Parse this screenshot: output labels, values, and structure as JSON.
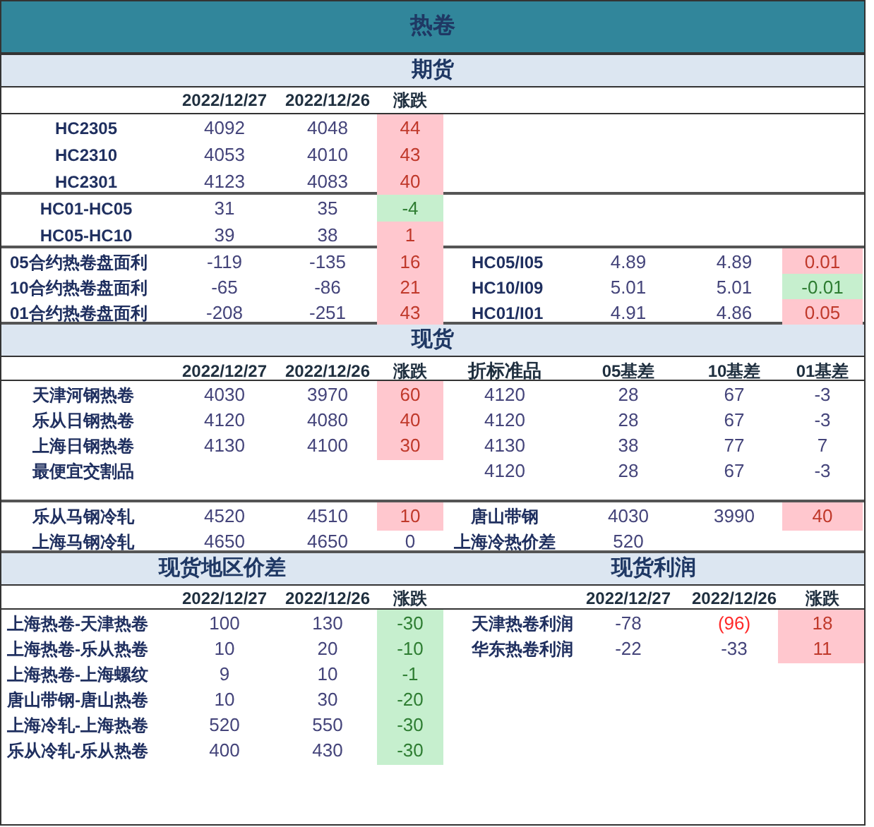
{
  "title": "热卷",
  "futures": {
    "heading": "期货",
    "columns": [
      "2022/12/27",
      "2022/12/26",
      "涨跌"
    ],
    "contracts": [
      {
        "name": "HC2305",
        "today": "4092",
        "prev": "4048",
        "change": "44",
        "gain": true,
        "loss": false
      },
      {
        "name": "HC2310",
        "today": "4053",
        "prev": "4010",
        "change": "43",
        "gain": true,
        "loss": false
      },
      {
        "name": "HC2301",
        "today": "4123",
        "prev": "4083",
        "change": "40",
        "gain": true,
        "loss": false
      }
    ],
    "spreads": [
      {
        "name": "HC01-HC05",
        "today": "31",
        "prev": "35",
        "change": "-4",
        "gain": false,
        "loss": true
      },
      {
        "name": "HC05-HC10",
        "today": "39",
        "prev": "38",
        "change": "1",
        "gain": true,
        "loss": false
      }
    ],
    "margins": [
      {
        "name": "05合约热卷盘面利",
        "today": "-119",
        "prev": "-135",
        "change": "16",
        "gain": true,
        "loss": false,
        "ratio": {
          "name": "HC05/I05",
          "today": "4.89",
          "prev": "4.89",
          "change": "0.01",
          "gain": true,
          "loss": false
        }
      },
      {
        "name": "10合约热卷盘面利",
        "today": "-65",
        "prev": "-86",
        "change": "21",
        "gain": true,
        "loss": false,
        "ratio": {
          "name": "HC10/I09",
          "today": "5.01",
          "prev": "5.01",
          "change": "-0.01",
          "gain": false,
          "loss": true
        }
      },
      {
        "name": "01合约热卷盘面利",
        "today": "-208",
        "prev": "-251",
        "change": "43",
        "gain": true,
        "loss": false,
        "ratio": {
          "name": "HC01/I01",
          "today": "4.91",
          "prev": "4.86",
          "change": "0.05",
          "gain": true,
          "loss": false
        }
      }
    ]
  },
  "spot": {
    "heading": "现货",
    "columns": [
      "2022/12/27",
      "2022/12/26",
      "涨跌",
      "折标准品",
      "05基差",
      "10基差",
      "01基差"
    ],
    "hot_rolled": [
      {
        "name": "天津河钢热卷",
        "today": "4030",
        "prev": "3970",
        "change": "60",
        "gain": true,
        "loss": false,
        "standard": "4120",
        "basis_05": "28",
        "basis_10": "67",
        "basis_01": "-3"
      },
      {
        "name": "乐从日钢热卷",
        "today": "4120",
        "prev": "4080",
        "change": "40",
        "gain": true,
        "loss": false,
        "standard": "4120",
        "basis_05": "28",
        "basis_10": "67",
        "basis_01": "-3"
      },
      {
        "name": "上海日钢热卷",
        "today": "4130",
        "prev": "4100",
        "change": "30",
        "gain": true,
        "loss": false,
        "standard": "4130",
        "basis_05": "38",
        "basis_10": "77",
        "basis_01": "7"
      },
      {
        "name": "最便宜交割品",
        "standard": "4120",
        "basis_05": "28",
        "basis_10": "67",
        "basis_01": "-3"
      }
    ],
    "cold_rolled": [
      {
        "name": "乐从马钢冷轧",
        "today": "4520",
        "prev": "4510",
        "change": "10",
        "gain": true,
        "loss": false,
        "side": {
          "name": "唐山带钢",
          "today": "4030",
          "prev": "3990",
          "change": "40",
          "gain": true,
          "loss": false
        }
      },
      {
        "name": "上海马钢冷轧",
        "today": "4650",
        "prev": "4650",
        "change": "0",
        "gain": false,
        "loss": false,
        "side": {
          "name": "上海冷热价差",
          "today": "520"
        }
      }
    ]
  },
  "regional_spreads": {
    "heading": "现货地区价差",
    "columns": [
      "2022/12/27",
      "2022/12/26",
      "涨跌"
    ],
    "rows": [
      {
        "name": "上海热卷-天津热卷",
        "today": "100",
        "prev": "130",
        "change": "-30",
        "gain": false,
        "loss": true
      },
      {
        "name": "上海热卷-乐从热卷",
        "today": "10",
        "prev": "20",
        "change": "-10",
        "gain": false,
        "loss": true
      },
      {
        "name": "上海热卷-上海螺纹",
        "today": "9",
        "prev": "10",
        "change": "-1",
        "gain": false,
        "loss": true
      },
      {
        "name": "唐山带钢-唐山热卷",
        "today": "10",
        "prev": "30",
        "change": "-20",
        "gain": false,
        "loss": true
      },
      {
        "name": "上海冷轧-上海热卷",
        "today": "520",
        "prev": "550",
        "change": "-30",
        "gain": false,
        "loss": true
      },
      {
        "name": "乐从冷轧-乐从热卷",
        "today": "400",
        "prev": "430",
        "change": "-30",
        "gain": false,
        "loss": true
      }
    ]
  },
  "spot_profit": {
    "heading": "现货利润",
    "columns": [
      "2022/12/27",
      "2022/12/26",
      "涨跌"
    ],
    "rows": [
      {
        "name": "天津热卷利润",
        "today": "-78",
        "prev": "(96)",
        "prev_red": true,
        "change": "18",
        "gain": true,
        "loss": false
      },
      {
        "name": "华东热卷利润",
        "today": "-22",
        "prev": "-33",
        "prev_red": false,
        "change": "11",
        "gain": true,
        "loss": false
      }
    ]
  }
}
